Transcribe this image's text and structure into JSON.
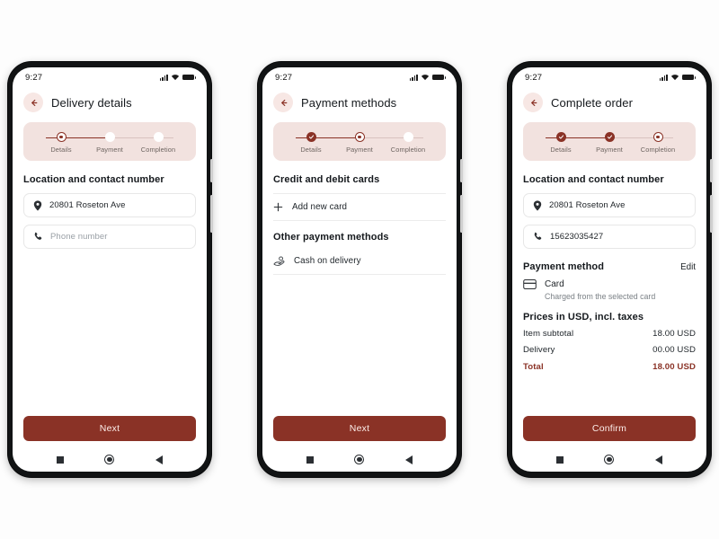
{
  "theme": {
    "accent": "#8a3226",
    "accent_soft": "#f2e2df",
    "back_button_bg": "#f7e7e4",
    "page_bg": "#fdfdfd",
    "frame": "#111314",
    "muted_text": "#7b8186",
    "border": "#e7e7e7"
  },
  "status_bar": {
    "time": "9:27",
    "icons": [
      "signal-icon",
      "wifi-icon",
      "battery-icon"
    ]
  },
  "nav_bar": {
    "items": [
      "recents-square-icon",
      "home-circle-icon",
      "back-triangle-icon"
    ]
  },
  "stepper": {
    "labels": [
      "Details",
      "Payment",
      "Completion"
    ]
  },
  "screens": [
    {
      "id": "delivery-details",
      "title": "Delivery details",
      "back_icon": "arrow-left-icon",
      "stepper_states": [
        "active",
        "upcoming",
        "upcoming"
      ],
      "section_title": "Location and contact number",
      "fields": [
        {
          "icon": "location-pin-icon",
          "value": "20801 Roseton Ave",
          "placeholder": "Address",
          "filled": true
        },
        {
          "icon": "phone-icon",
          "value": "",
          "placeholder": "Phone number",
          "filled": false
        }
      ],
      "cta": "Next"
    },
    {
      "id": "payment-methods",
      "title": "Payment methods",
      "back_icon": "arrow-left-icon",
      "stepper_states": [
        "done",
        "active",
        "upcoming"
      ],
      "cards_section_title": "Credit and debit cards",
      "add_card_label": "Add new card",
      "add_card_icon": "plus-icon",
      "other_section_title": "Other payment methods",
      "cash_label": "Cash on delivery",
      "cash_icon": "hand-cash-icon",
      "cta": "Next"
    },
    {
      "id": "complete-order",
      "title": "Complete order",
      "back_icon": "arrow-left-icon",
      "stepper_states": [
        "done",
        "done",
        "active"
      ],
      "section_title": "Location and contact number",
      "fields": [
        {
          "icon": "location-pin-icon",
          "value": "20801 Roseton Ave",
          "filled": true
        },
        {
          "icon": "phone-icon",
          "value": "15623035427",
          "filled": true
        }
      ],
      "payment_heading": "Payment method",
      "edit_label": "Edit",
      "payment_method_icon": "credit-card-icon",
      "payment_method_label": "Card",
      "payment_method_sub": "Charged from the selected card",
      "prices_heading": "Prices in USD, incl. taxes",
      "prices": [
        {
          "label": "Item subtotal",
          "value": "18.00 USD"
        },
        {
          "label": "Delivery",
          "value": "00.00 USD"
        }
      ],
      "total": {
        "label": "Total",
        "value": "18.00 USD"
      },
      "cta": "Confirm"
    }
  ]
}
